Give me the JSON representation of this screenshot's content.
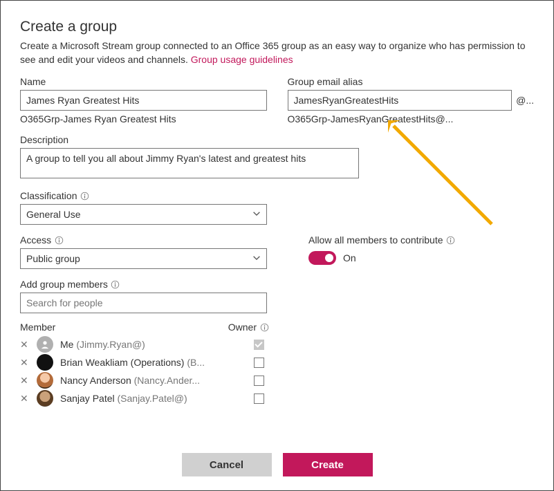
{
  "header": {
    "title": "Create a group",
    "subtitle_before": "Create a Microsoft Stream group connected to an Office 365 group as an easy way to organize who has permission to see and edit your videos and channels. ",
    "subtitle_link": "Group usage guidelines"
  },
  "name": {
    "label": "Name",
    "value": "James Ryan Greatest Hits",
    "hint": "O365Grp-James Ryan Greatest Hits"
  },
  "alias": {
    "label": "Group email alias",
    "value": "JamesRyanGreatestHits",
    "suffix": "@...",
    "hint": "O365Grp-JamesRyanGreatestHits@..."
  },
  "description": {
    "label": "Description",
    "value": "A group to tell you all about Jimmy Ryan's latest and greatest hits"
  },
  "classification": {
    "label": "Classification",
    "value": "General Use"
  },
  "access": {
    "label": "Access",
    "value": "Public group"
  },
  "contribute": {
    "label": "Allow all members to contribute",
    "on_label": "On"
  },
  "add_members": {
    "label": "Add group members",
    "placeholder": "Search for people"
  },
  "members_table": {
    "col_member": "Member",
    "col_owner": "Owner",
    "rows": [
      {
        "name": "Me",
        "paren": "(Jimmy.Ryan@)",
        "avatar": "grey",
        "owner_locked": true
      },
      {
        "name": "Brian Weakliam (Operations)",
        "paren": "(B...",
        "avatar": "black",
        "owner_locked": false
      },
      {
        "name": "Nancy Anderson",
        "paren": "(Nancy.Ander...",
        "avatar": "img1",
        "owner_locked": false
      },
      {
        "name": "Sanjay Patel",
        "paren": "(Sanjay.Patel@)",
        "avatar": "img2",
        "owner_locked": false
      }
    ]
  },
  "footer": {
    "cancel": "Cancel",
    "create": "Create"
  }
}
